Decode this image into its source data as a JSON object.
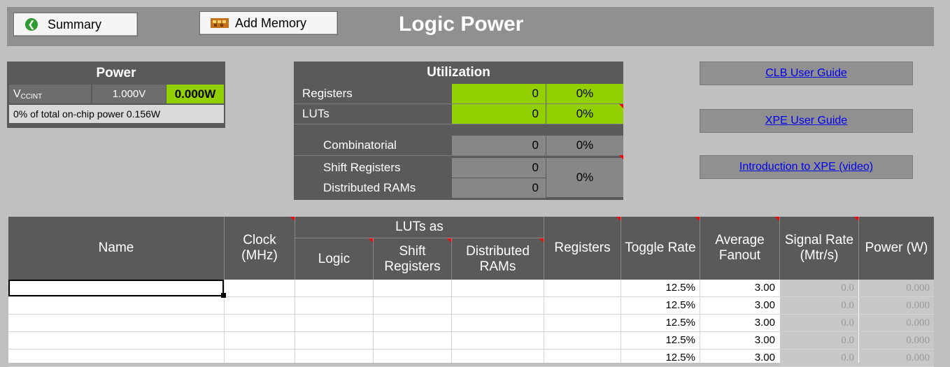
{
  "toolbar": {
    "summary_label": "Summary",
    "add_memory_label": "Add Memory",
    "title": "Logic Power"
  },
  "power": {
    "title": "Power",
    "supply_name": "V",
    "supply_sub": "CCINT",
    "voltage": "1.000V",
    "power": "0.000W",
    "note": "0% of total on-chip power 0.156W"
  },
  "utilization": {
    "title": "Utilization",
    "rows": [
      {
        "label": "Registers",
        "value": "0",
        "pct": "0%"
      },
      {
        "label": "LUTs",
        "value": "0",
        "pct": "0%"
      },
      {
        "label": "Combinatorial",
        "value": "0",
        "pct": "0%"
      },
      {
        "label": "Shift Registers",
        "value": "0"
      },
      {
        "label": "Distributed RAMs",
        "value": "0"
      }
    ],
    "shared_pct": "0%"
  },
  "links": {
    "clb": "CLB User Guide",
    "xpe": "XPE User Guide",
    "intro": "Introduction to XPE (video)"
  },
  "table": {
    "headers": {
      "name": "Name",
      "clock": "Clock (MHz)",
      "luts_as": "LUTs as",
      "logic": "Logic",
      "shift": "Shift Registers",
      "dist": "Distributed RAMs",
      "registers": "Registers",
      "toggle": "Toggle Rate",
      "fanout": "Average Fanout",
      "signal": "Signal Rate (Mtr/s)",
      "power": "Power (W)"
    },
    "rows": [
      {
        "toggle": "12.5%",
        "fanout": "3.00",
        "signal": "0.0",
        "power": "0.000"
      },
      {
        "toggle": "12.5%",
        "fanout": "3.00",
        "signal": "0.0",
        "power": "0.000"
      },
      {
        "toggle": "12.5%",
        "fanout": "3.00",
        "signal": "0.0",
        "power": "0.000"
      },
      {
        "toggle": "12.5%",
        "fanout": "3.00",
        "signal": "0.0",
        "power": "0.000"
      },
      {
        "toggle": "12.5%",
        "fanout": "3.00",
        "signal": "0.0",
        "power": "0.000"
      }
    ]
  },
  "colors": {
    "green": "#92d000",
    "header": "#5a5a5a",
    "link": "#0000ee"
  }
}
